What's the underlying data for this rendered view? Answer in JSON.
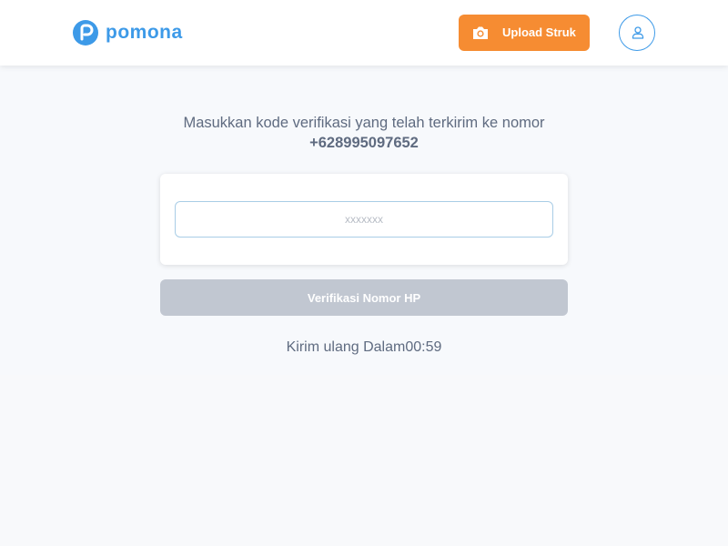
{
  "header": {
    "brand": "pomona",
    "upload_label": "Upload Struk",
    "upload_icon": "camera-icon",
    "profile_icon": "user-icon"
  },
  "verification": {
    "instruction": "Masukkan kode verifikasi yang telah terkirim ke nomor",
    "phone_number": "+628995097652",
    "code_value": "",
    "code_placeholder": "xxxxxxx",
    "verify_label": "Verifikasi Nomor HP",
    "resend_label": "Kirim ulang Dalam",
    "resend_timer": "00:59"
  },
  "colors": {
    "brand_blue": "#3d9ae8",
    "accent_orange": "#f68c32",
    "disabled_button": "#c1c7d1",
    "text_muted": "#5f6b80"
  }
}
